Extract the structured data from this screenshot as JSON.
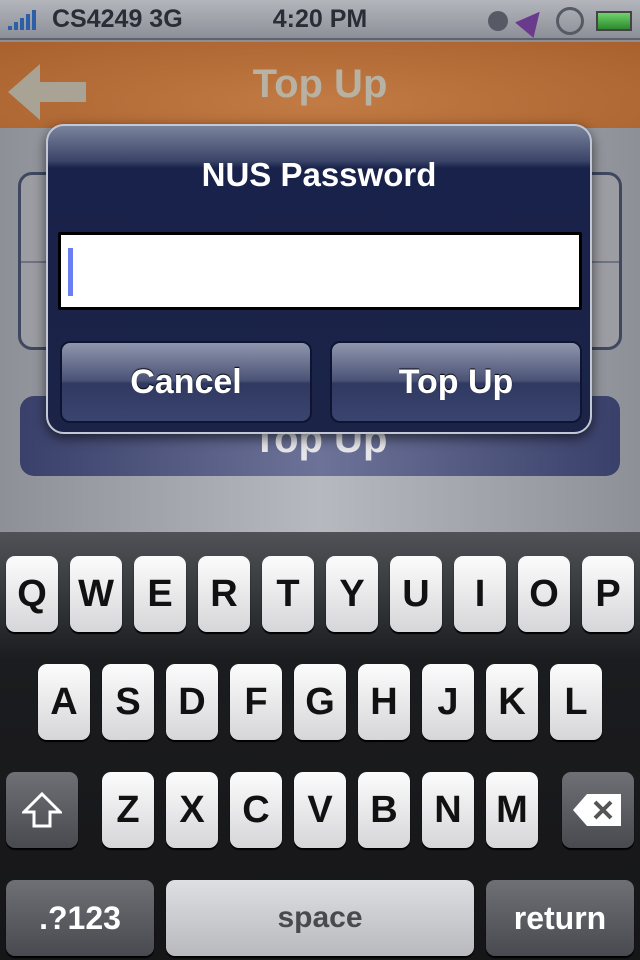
{
  "status": {
    "carrier": "CS4249 3G",
    "time": "4:20 PM",
    "signal_bars": 5
  },
  "nav": {
    "title": "Top Up",
    "back_icon": "arrow-left-icon"
  },
  "content": {
    "button": "Top Up"
  },
  "dialog": {
    "title": "NUS Password",
    "input_value": "",
    "cancel": "Cancel",
    "confirm": "Top Up"
  },
  "keyboard": {
    "row1": [
      "Q",
      "W",
      "E",
      "R",
      "T",
      "Y",
      "U",
      "I",
      "O",
      "P"
    ],
    "row2": [
      "A",
      "S",
      "D",
      "F",
      "G",
      "H",
      "J",
      "K",
      "L"
    ],
    "row3": [
      "Z",
      "X",
      "C",
      "V",
      "B",
      "N",
      "M"
    ],
    "numbers": ".?123",
    "space": "space",
    "return": "return"
  },
  "colors": {
    "nav": "#b06a37",
    "dialog": "#1b2347",
    "caret": "#6a7ef0"
  }
}
